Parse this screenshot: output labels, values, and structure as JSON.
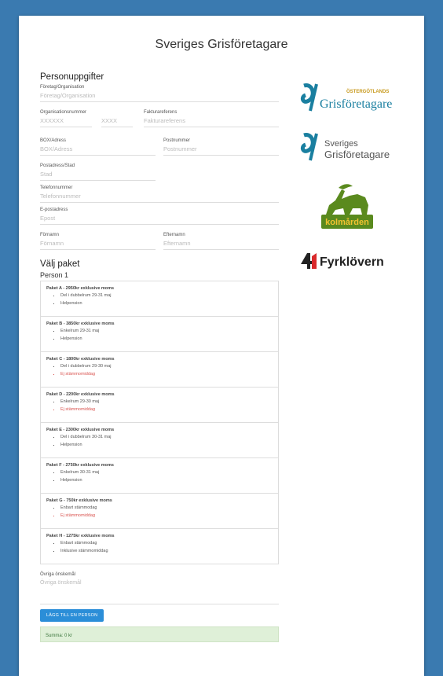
{
  "header": {
    "title": "Sveriges Grisföretagare"
  },
  "personal": {
    "heading": "Personuppgifter",
    "company": {
      "label": "Företag/Organisation",
      "placeholder": "Företag/Organisation"
    },
    "orgnr": {
      "label": "Organisationsnummer",
      "placeholder1": "XXXXXX",
      "placeholder2": "XXXX"
    },
    "invoice_ref": {
      "label": "Fakturareferens",
      "placeholder": "Fakturareferens"
    },
    "box": {
      "label": "BOX/Adress",
      "placeholder": "BOX/Adress"
    },
    "zip": {
      "label": "Postnummer",
      "placeholder": "Postnummer"
    },
    "city": {
      "label": "Postadress/Stad",
      "placeholder": "Stad"
    },
    "phone": {
      "label": "Telefonnummer",
      "placeholder": "Telefonnummer"
    },
    "email": {
      "label": "E-postadress",
      "placeholder": "Epost"
    },
    "firstname": {
      "label": "Förnamn",
      "placeholder": "Förnamn"
    },
    "lastname": {
      "label": "Efternamn",
      "placeholder": "Efternamn"
    }
  },
  "packages": {
    "heading": "Välj paket",
    "person": "Person 1",
    "items": [
      {
        "title": "Paket A - 2950kr exklusive moms",
        "lines": [
          {
            "t": "Del i dubbelrum 29-31 maj",
            "warn": false
          },
          {
            "t": "Helpension",
            "warn": false
          }
        ]
      },
      {
        "title": "Paket B - 3850kr exklusive moms",
        "lines": [
          {
            "t": "Enkelrum 29-31 maj",
            "warn": false
          },
          {
            "t": "Helpension",
            "warn": false
          }
        ]
      },
      {
        "title": "Paket C - 1800kr exklusive moms",
        "lines": [
          {
            "t": "Del i dubbelrum 29-30 maj",
            "warn": false
          },
          {
            "t": "Ej stämmomiddag",
            "warn": true
          }
        ]
      },
      {
        "title": "Paket D - 2200kr exklusive moms",
        "lines": [
          {
            "t": "Enkelrum 29-30 maj",
            "warn": false
          },
          {
            "t": "Ej stämmomiddag",
            "warn": true
          }
        ]
      },
      {
        "title": "Paket E - 2300kr exklusive moms",
        "lines": [
          {
            "t": "Del i dubbelrum 30-31 maj",
            "warn": false
          },
          {
            "t": "Helpension",
            "warn": false
          }
        ]
      },
      {
        "title": "Paket F - 2750kr exklusive moms",
        "lines": [
          {
            "t": "Enkelrum 30-31 maj",
            "warn": false
          },
          {
            "t": "Helpension",
            "warn": false
          }
        ]
      },
      {
        "title": "Paket G - 750kr exklusive moms",
        "lines": [
          {
            "t": "Enbart stämmodag",
            "warn": false
          },
          {
            "t": "Ej stämmomiddag",
            "warn": true
          }
        ]
      },
      {
        "title": "Paket H - 1275kr exklusive moms",
        "lines": [
          {
            "t": "Enbart stämmodag",
            "warn": false
          },
          {
            "t": "Inklusive stämmomiddag",
            "warn": false
          }
        ]
      }
    ]
  },
  "other": {
    "label": "Övriga önskemål",
    "placeholder": "Övriga önskemål"
  },
  "add_button": "LÄGG TILL EN PERSON",
  "sum": "Summa: 0 kr",
  "logos": {
    "ostergotland": {
      "small": "ÖSTERGÖTLANDS",
      "big": "Grisföretagare"
    },
    "sveriges": {
      "line1": "Sveriges",
      "line2": "Grisföretagare"
    },
    "kolmarden": "kolmården",
    "fyrklovern": "Fyrklövern"
  },
  "colors": {
    "background": "#3a7ab0",
    "button": "#2b8ed8",
    "warn": "#d9534f",
    "teal": "#1a7fa0",
    "green": "#5a8a1e"
  }
}
